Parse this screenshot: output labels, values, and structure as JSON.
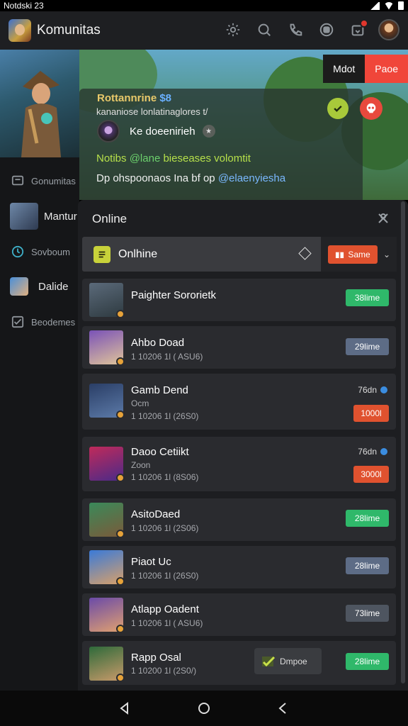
{
  "status_bar": {
    "time": "Notdski 23"
  },
  "app_bar": {
    "title": "Komunitas"
  },
  "sidebar": {
    "items": [
      {
        "label": "Gonumitas",
        "icon": "chat-icon"
      },
      {
        "label": "Mantur",
        "icon": "avatar"
      },
      {
        "label": "Sovboum",
        "icon": "clock-icon"
      },
      {
        "label": "Dalide",
        "icon": "avatar"
      },
      {
        "label": "Beodemes",
        "icon": "checkbox-icon"
      }
    ]
  },
  "hero": {
    "mute_label": "Mdot",
    "pause_label": "Paoe",
    "card": {
      "title": "Rottannrine",
      "title_tag": "$8",
      "subtitle": "kananiose lonlatinaglores t/",
      "user_name": "Ke doeenirieh",
      "line1_start": "Notibs",
      "line1_mid": "@lane",
      "line1_end": "bieseases volomtit",
      "line2_start": "Dp ohspoonaos Ina bf op",
      "line2_link": "@elaenyiesha"
    }
  },
  "panel": {
    "title": "Online",
    "filter": {
      "label": "Onlhine",
      "button_label": "Same"
    },
    "rows": [
      {
        "name": "Paighter Sororietk",
        "sub": "",
        "sub2": "",
        "badge": "38lime",
        "badge_color": "green",
        "time": "",
        "done": ""
      },
      {
        "name": "Ahbo Doad",
        "sub": "1 10206 1l ( ASU6)",
        "sub2": "",
        "badge": "29lime",
        "badge_color": "slate",
        "time": "",
        "done": ""
      },
      {
        "name": "Gamb Dend",
        "sub": "Ocm",
        "sub2": "1 10206 1l (26S0)",
        "badge": "1000l",
        "badge_color": "orange",
        "time": "76dn",
        "done": ""
      },
      {
        "name": "Daoo Cetiikt",
        "sub": "Zoon",
        "sub2": "1 10206 1l (8S06)",
        "badge": "3000l",
        "badge_color": "orange",
        "time": "76dn",
        "done": ""
      },
      {
        "name": "AsitoDaed",
        "sub": "1 10206 1l (2S06)",
        "sub2": "",
        "badge": "28lime",
        "badge_color": "green",
        "time": "",
        "done": ""
      },
      {
        "name": "Piaot Uc",
        "sub": "1 10206 1l (26S0)",
        "sub2": "",
        "badge": "28lime",
        "badge_color": "slate",
        "time": "",
        "done": ""
      },
      {
        "name": "Atlapp Oadent",
        "sub": "1 10206 1l ( ASU6)",
        "sub2": "",
        "badge": "73lime",
        "badge_color": "slate",
        "time": "",
        "done": ""
      },
      {
        "name": "Rapp Osal",
        "sub": "1 10200 1l (2S0/)",
        "sub2": "",
        "badge": "28lime",
        "badge_color": "green",
        "time": "",
        "done": "Dmpoe"
      }
    ]
  }
}
